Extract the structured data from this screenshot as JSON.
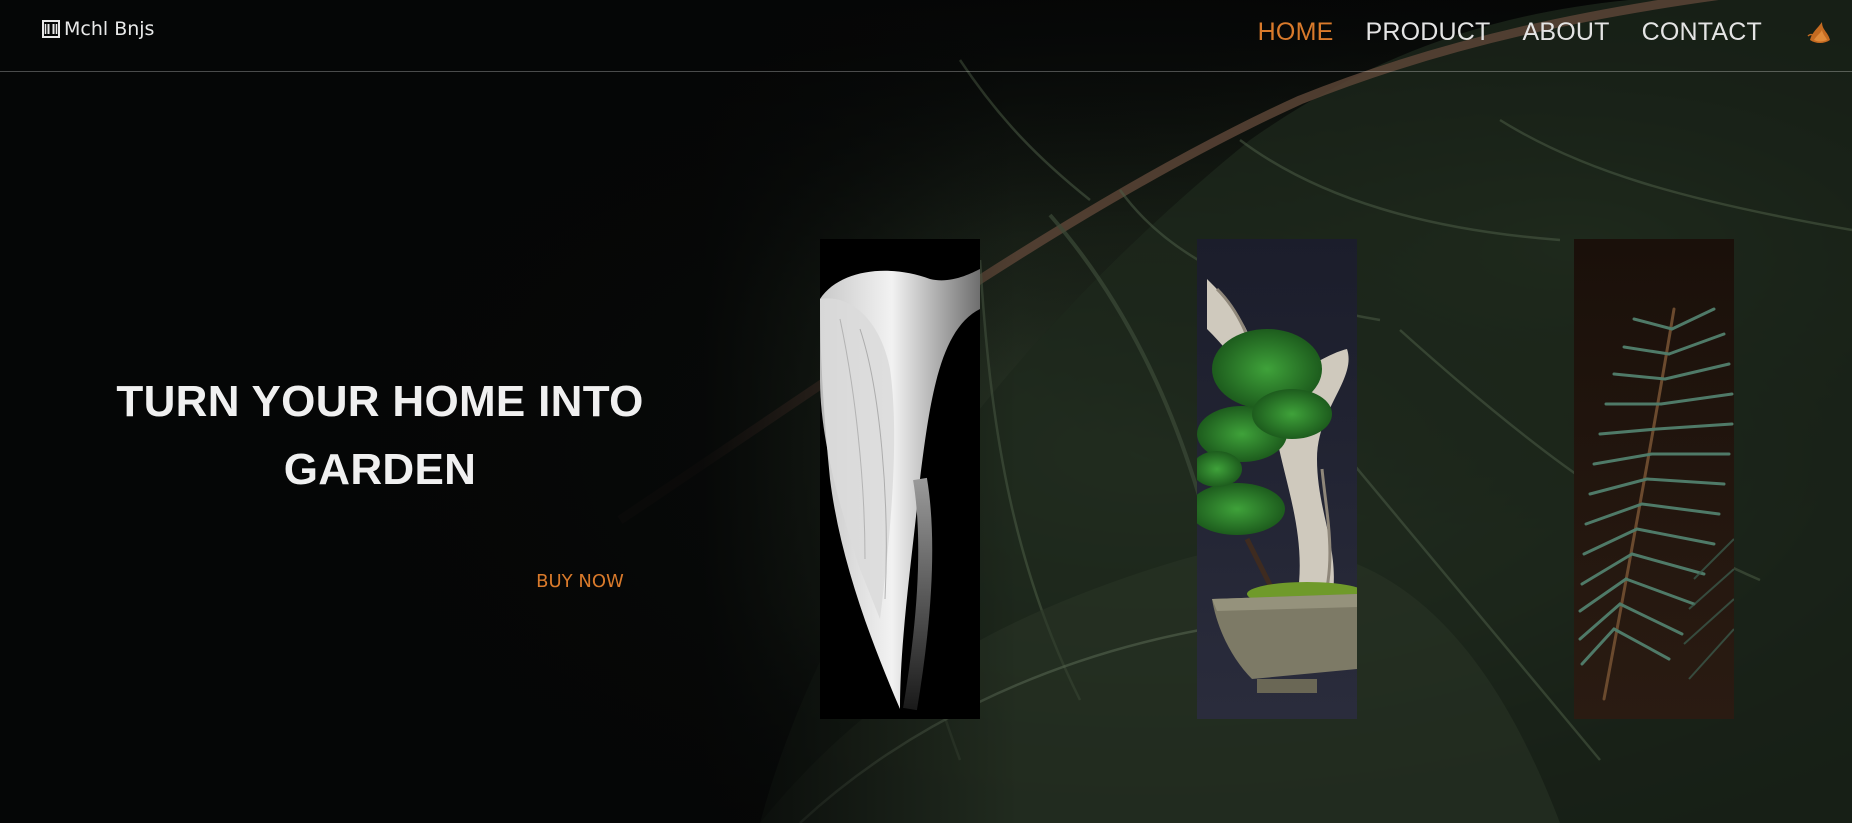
{
  "brand": {
    "name": "Mchl Bnjs",
    "icon": "columns-icon"
  },
  "nav": {
    "items": [
      {
        "label": "HOME",
        "active": true
      },
      {
        "label": "PRODUCT",
        "active": false
      },
      {
        "label": "ABOUT",
        "active": false
      },
      {
        "label": "CONTACT",
        "active": false
      }
    ],
    "logo_icon": "flame-leaf-icon"
  },
  "hero": {
    "title_line1": "TURN YOUR HOME INTO",
    "title_line2": "GARDEN",
    "cta_label": "BUY NOW"
  },
  "gallery": [
    {
      "name": "calla-lily-image"
    },
    {
      "name": "bonsai-tree-image"
    },
    {
      "name": "fern-image"
    }
  ],
  "colors": {
    "accent": "#d97a2b",
    "background": "#050606",
    "text": "#f0f0f0"
  }
}
